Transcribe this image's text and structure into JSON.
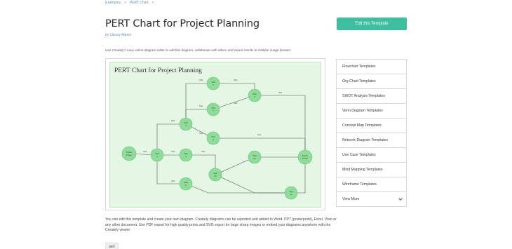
{
  "breadcrumb": {
    "items": [
      "Examples",
      "PERT Chart"
    ],
    "separator": ">"
  },
  "title": "PERT Chart for Project Planning",
  "byline": "by Library Admin",
  "edit_button": "Edit this Template",
  "description": "Use Creately’s easy online diagram editor to edit this diagram, collaborate with others and export results to multiple image formats.",
  "diagram": {
    "title": "PERT Chart  for  Project  Planning",
    "accent_color": "#8fdc9a",
    "background_color": "#e4f7e4",
    "nodes": [
      {
        "id": "start",
        "label": "Initiate Phase"
      },
      {
        "id": "t2",
        "label": "Task 2"
      },
      {
        "id": "t3",
        "label": "Task 3"
      },
      {
        "id": "t4",
        "label": "Task 4"
      },
      {
        "id": "t5",
        "label": "Task 5"
      },
      {
        "id": "t6",
        "label": "Task 6"
      },
      {
        "id": "t7",
        "label": "Task 7"
      },
      {
        "id": "t8",
        "label": "Task 8"
      },
      {
        "id": "t9",
        "label": "Task 9"
      },
      {
        "id": "t10",
        "label": "Task 10"
      },
      {
        "id": "t11",
        "label": "Task 11"
      },
      {
        "id": "t12",
        "label": "Task 12"
      },
      {
        "id": "t13",
        "label": "Task 13"
      },
      {
        "id": "end",
        "label": "Finish Phase"
      }
    ],
    "edge_labels": [
      "Task",
      "Task",
      "Task",
      "Task",
      "Task",
      "Task",
      "Task",
      "Task",
      "Task",
      "Task",
      "Task",
      "Task"
    ]
  },
  "sidebar": {
    "items": [
      "Flowchart Templates",
      "Org Chart Templates",
      "SWOT Analysis Templates",
      "Venn Diagram Templates",
      "Concept Map Templates",
      "Network Diagram Templates",
      "Use Case Templates",
      "Mind Mapping Templates",
      "Wireframe Templates"
    ],
    "more": "View More"
  },
  "body_text": "You can edit this template and create your own diagram. Creately diagrams can be exported and added to Word, PPT (powerpoint), Excel, Visio or any other document. Use PDF export for high quality prints and SVG export for large sharp images or embed your diagrams anywhere with the Creately viewer.",
  "tags": [
    "pert"
  ],
  "colors": {
    "button": "#3fbf9f",
    "link": "#6a8fb5"
  }
}
